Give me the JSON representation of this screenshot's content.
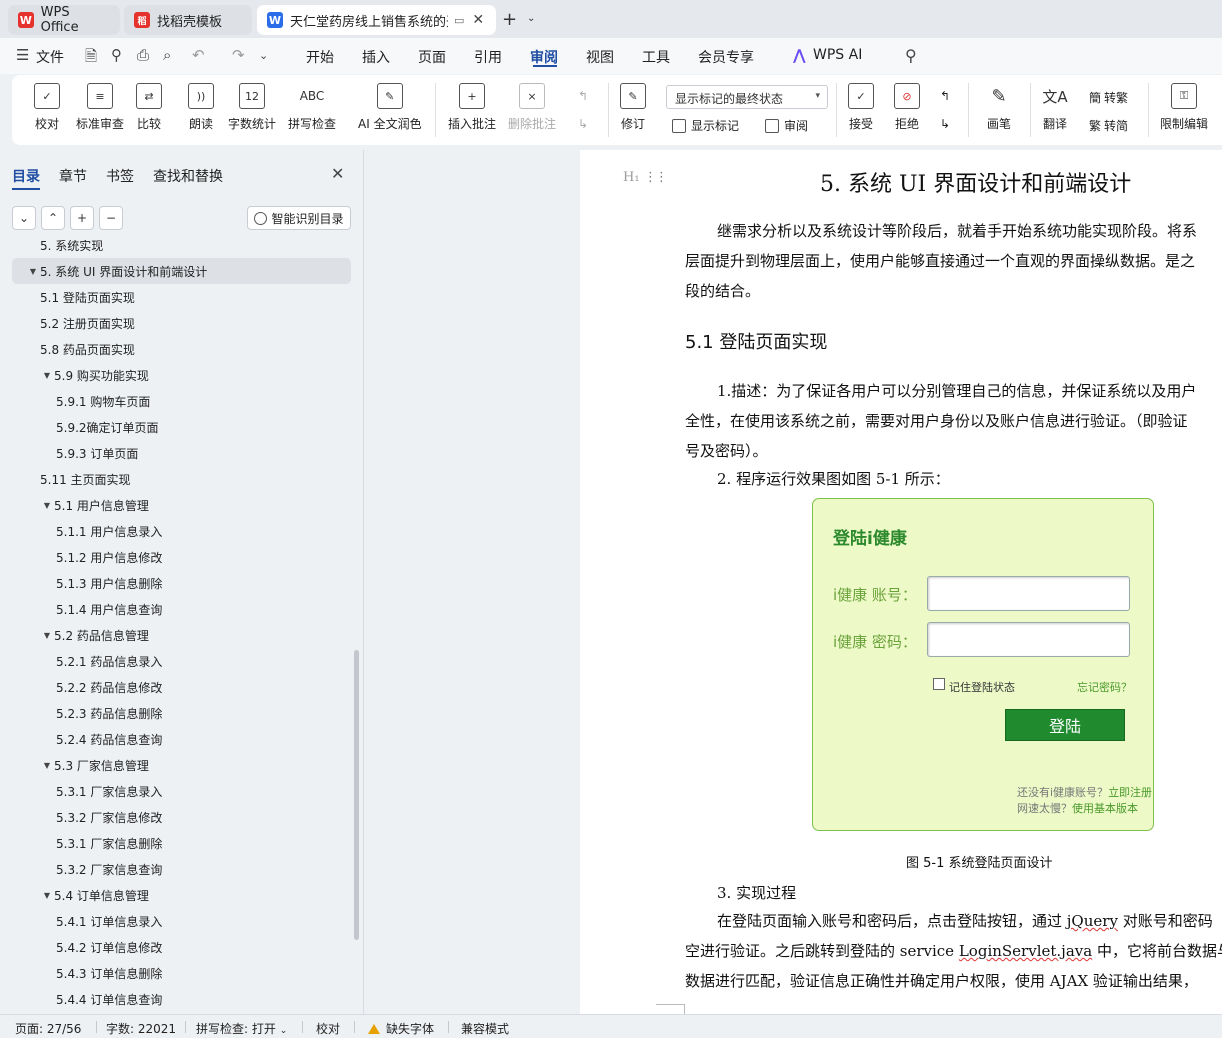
{
  "tabs": [
    {
      "label": "WPS Office",
      "logo": "W"
    },
    {
      "label": "找稻壳模板",
      "logo": "稻"
    },
    {
      "label": "天仁堂药房线上销售系统的开",
      "logo": "W"
    }
  ],
  "menu": {
    "file": "文件",
    "items": [
      "开始",
      "插入",
      "页面",
      "引用",
      "审阅",
      "视图",
      "工具",
      "会员专享"
    ],
    "active": "审阅",
    "ai": "WPS AI"
  },
  "ribbon": {
    "proofread": "校对",
    "standard_review": "标准审查",
    "compare": "比较",
    "read_aloud": "朗读",
    "word_count": "字数统计",
    "word_count_icon": "12",
    "spell_check": "拼写检查",
    "spell_icon": "ABC",
    "ai_polish": "AI 全文润色",
    "insert_comment": "插入批注",
    "delete_comment": "删除批注",
    "revise": "修订",
    "display_select": "显示标记的最终状态",
    "show_markup": "显示标记",
    "review": "审阅",
    "accept": "接受",
    "reject": "拒绝",
    "pen": "画笔",
    "translate": "翻译",
    "to_traditional": "转繁",
    "to_simplified": "转简",
    "restrict_edit": "限制编辑"
  },
  "nav": {
    "tabs": [
      "目录",
      "章节",
      "书签",
      "查找和替换"
    ],
    "smart_toc": "智能识别目录",
    "toc": [
      {
        "label": "5.  系统实现",
        "level": 1,
        "arrow": false
      },
      {
        "label": "5.  系统 UI 界面设计和前端设计",
        "level": 1,
        "arrow": true,
        "selected": true
      },
      {
        "label": "5.1  登陆页面实现",
        "level": 2,
        "arrow": false
      },
      {
        "label": "5.2  注册页面实现",
        "level": 2,
        "arrow": false
      },
      {
        "label": "5.8  药品页面实现",
        "level": 2,
        "arrow": false
      },
      {
        "label": "5.9  购买功能实现",
        "level": 2,
        "arrow": true
      },
      {
        "label": "5.9.1  购物车页面",
        "level": 3,
        "arrow": false
      },
      {
        "label": "5.9.2确定订单页面",
        "level": 3,
        "arrow": false
      },
      {
        "label": "5.9.3  订单页面",
        "level": 3,
        "arrow": false
      },
      {
        "label": "5.11  主页面实现",
        "level": 2,
        "arrow": false
      },
      {
        "label": "5.1  用户信息管理",
        "level": 2,
        "arrow": true
      },
      {
        "label": "5.1.1  用户信息录入",
        "level": 3,
        "arrow": false
      },
      {
        "label": "5.1.2  用户信息修改",
        "level": 3,
        "arrow": false
      },
      {
        "label": "5.1.3  用户信息删除",
        "level": 3,
        "arrow": false
      },
      {
        "label": "5.1.4  用户信息查询",
        "level": 3,
        "arrow": false
      },
      {
        "label": "5.2  药品信息管理",
        "level": 2,
        "arrow": true
      },
      {
        "label": "5.2.1  药品信息录入",
        "level": 3,
        "arrow": false
      },
      {
        "label": "5.2.2  药品信息修改",
        "level": 3,
        "arrow": false
      },
      {
        "label": "5.2.3  药品信息删除",
        "level": 3,
        "arrow": false
      },
      {
        "label": "5.2.4  药品信息查询",
        "level": 3,
        "arrow": false
      },
      {
        "label": "5.3  厂家信息管理",
        "level": 2,
        "arrow": true
      },
      {
        "label": "5.3.1  厂家信息录入",
        "level": 3,
        "arrow": false
      },
      {
        "label": "5.3.2  厂家信息修改",
        "level": 3,
        "arrow": false
      },
      {
        "label": "5.3.1  厂家信息删除",
        "level": 3,
        "arrow": false
      },
      {
        "label": "5.3.2  厂家信息查询",
        "level": 3,
        "arrow": false
      },
      {
        "label": "5.4  订单信息管理",
        "level": 2,
        "arrow": true
      },
      {
        "label": "5.4.1  订单信息录入",
        "level": 3,
        "arrow": false
      },
      {
        "label": "5.4.2  订单信息修改",
        "level": 3,
        "arrow": false
      },
      {
        "label": "5.4.3  订单信息删除",
        "level": 3,
        "arrow": false
      },
      {
        "label": "5.4.4  订单信息查询",
        "level": 3,
        "arrow": false
      }
    ]
  },
  "doc": {
    "h1": "5.  系统 UI 界面设计和前端设计",
    "p1": [
      "继需求分析以及系统设计等阶段后，就着手开始系统功能实现阶段。将系",
      "层面提升到物理层面上，使用户能够直接通过一个直观的界面操纵数据。是之",
      "段的结合。"
    ],
    "h2": "5.1  登陆页面实现",
    "p2": [
      "1.描述：为了保证各用户可以分别管理自己的信息，并保证系统以及用户",
      "全性，在使用该系统之前，需要对用户身份以及账户信息进行验证。（即验证",
      "号及密码）。"
    ],
    "p3": "2.  程序运行效果图如图 5-1 所示：",
    "figure": {
      "title": "登陆i健康",
      "account_label": "i健康 账号：",
      "password_label": "i健康 密码：",
      "remember": "记住登陆状态",
      "forgot": "忘记密码？",
      "login": "登陆",
      "register_prefix": "还没有i健康账号？",
      "register_link": "立即注册",
      "slow_prefix": "网速太慢？",
      "slow_link": "使用基本版本"
    },
    "caption": "图 5-1  系统登陆页面设计",
    "p4": "3.  实现过程",
    "p5a": "在登陆页面输入账号和密码后，点击登陆按钮，通过 ",
    "p5b": "jQuery",
    "p5c": " 对账号和密码",
    "p6a": "空进行验证。之后跳转到登陆的 service ",
    "p6b": "LoginServlet.java",
    "p6c": " 中，它将前台数据与",
    "p7": "数据进行匹配，验证信息正确性并确定用户权限，使用 AJAX 验证输出结果，"
  },
  "status": {
    "page": "页面: 27/56",
    "words": "字数: 22021",
    "spell": "拼写检查: 打开",
    "proof": "校对",
    "missing_font": "缺失字体",
    "compat": "兼容模式"
  },
  "colors": {
    "accent": "#1f4ea3",
    "login_green": "#1f8a2e",
    "figure_bg": "#eef9c8"
  }
}
